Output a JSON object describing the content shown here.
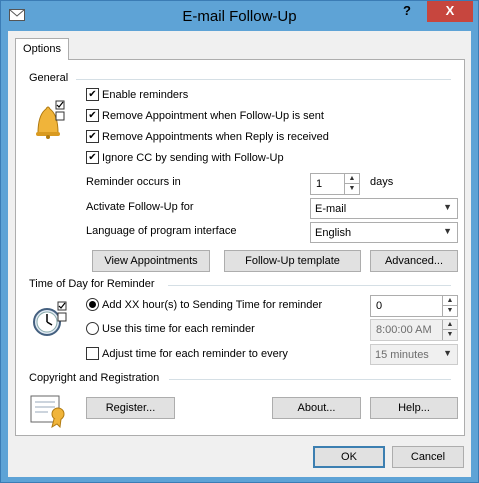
{
  "window": {
    "title": "E-mail Follow-Up",
    "help_glyph": "?",
    "close_glyph": "X"
  },
  "tabs": [
    {
      "label": "Options",
      "selected": true
    }
  ],
  "general": {
    "label": "General",
    "checkboxes": [
      {
        "label": "Enable reminders",
        "checked": true
      },
      {
        "label": "Remove Appointment when Follow-Up is sent",
        "checked": true
      },
      {
        "label": "Remove Appointments when Reply is received",
        "checked": true
      },
      {
        "label": "Ignore CC by sending with Follow-Up",
        "checked": true
      }
    ],
    "reminder": {
      "label": "Reminder occurs in",
      "value": "1",
      "unit": "days"
    },
    "activate": {
      "label": "Activate Follow-Up for",
      "value": "E-mail"
    },
    "language": {
      "label": "Language of program interface",
      "value": "English"
    },
    "buttons": {
      "view": "View Appointments",
      "template": "Follow-Up template",
      "advanced": "Advanced..."
    }
  },
  "time_of_day": {
    "label": "Time of Day for Reminder",
    "radio_add": {
      "label": "Add XX hour(s) to Sending Time for reminder",
      "selected": true,
      "value": "0"
    },
    "radio_use": {
      "label": "Use this time for each reminder",
      "selected": false,
      "value": "8:00:00 AM"
    },
    "adjust": {
      "label": "Adjust time for each reminder to every",
      "checked": false,
      "value": "15 minutes"
    }
  },
  "copyright": {
    "label": "Copyright and Registration",
    "register": "Register...",
    "about": "About...",
    "help": "Help..."
  },
  "footer": {
    "ok": "OK",
    "cancel": "Cancel"
  },
  "colors": {
    "titlebar": "#5ea3d6",
    "close": "#c7463e",
    "bell": "#f0b43a",
    "accent": "#3c7fb1"
  }
}
